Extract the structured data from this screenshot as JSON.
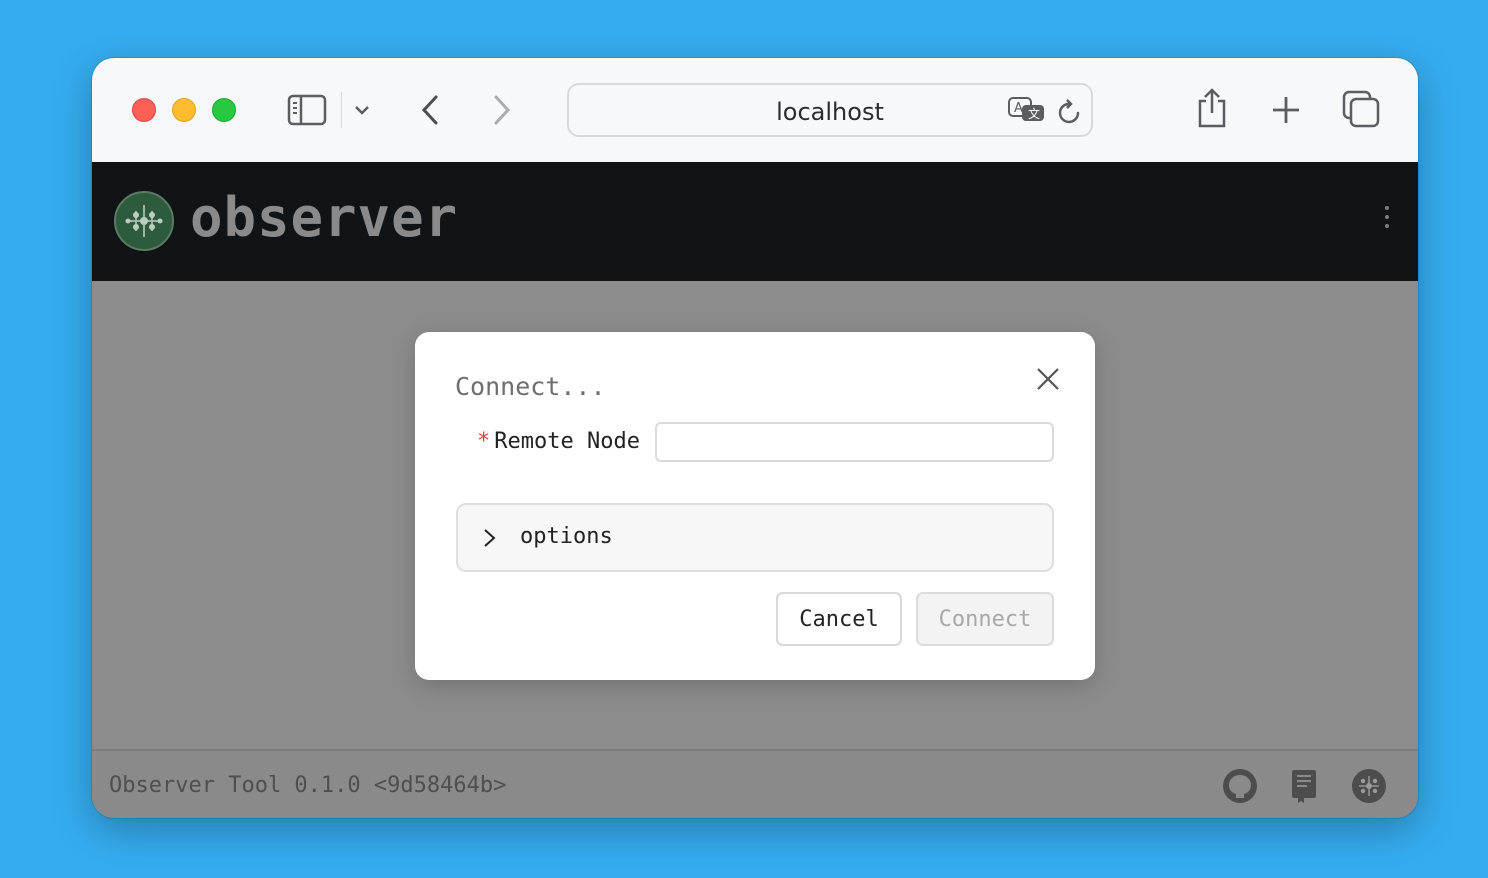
{
  "browser": {
    "url": "localhost",
    "icons": [
      "sidebar-icon",
      "chevron-down-icon",
      "back-icon",
      "forward-icon",
      "translate-icon",
      "reload-icon",
      "share-icon",
      "new-tab-icon",
      "tabs-icon"
    ]
  },
  "app": {
    "brand": "observer",
    "logo_icon": "observer-logo-icon",
    "menu_icon": "kebab-menu-icon"
  },
  "dialog": {
    "title": "Connect...",
    "close_icon": "close-icon",
    "field": {
      "required_mark": "*",
      "label": "Remote Node :",
      "value": "",
      "placeholder": ""
    },
    "options_label": "options",
    "cancel_label": "Cancel",
    "connect_label": "Connect"
  },
  "footer": {
    "version_text": "Observer Tool 0.1.0 <9d58464b>",
    "icons": [
      "github-icon",
      "docs-icon",
      "observer-icon"
    ]
  },
  "colors": {
    "desktop": "#35acef",
    "header": "#111417",
    "overlay": "#8c8c8c",
    "required": "#e04040"
  }
}
